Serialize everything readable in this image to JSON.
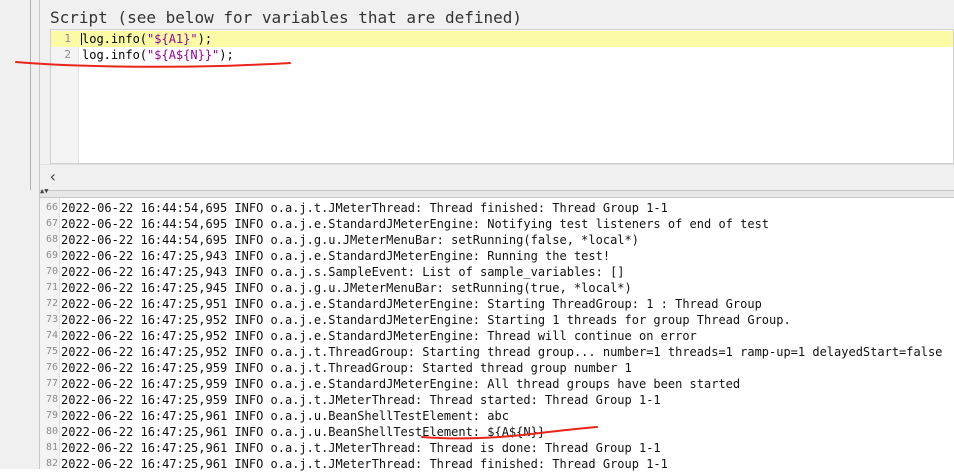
{
  "script": {
    "title": "Script (see below for variables that are defined)",
    "lines": [
      {
        "number": "1",
        "prefix": "log.info(",
        "string": "\"${A1}\"",
        "suffix": ");"
      },
      {
        "number": "2",
        "prefix": "log.info(",
        "string": "\"${A${N}}\"",
        "suffix": ");"
      }
    ],
    "scroll_left_icon": "chevron-left-icon"
  },
  "log": {
    "lines": [
      {
        "n": "66",
        "text": "2022-06-22 16:44:54,695 INFO o.a.j.t.JMeterThread: Thread finished: Thread Group 1-1"
      },
      {
        "n": "67",
        "text": "2022-06-22 16:44:54,695 INFO o.a.j.e.StandardJMeterEngine: Notifying test listeners of end of test"
      },
      {
        "n": "68",
        "text": "2022-06-22 16:44:54,695 INFO o.a.j.g.u.JMeterMenuBar: setRunning(false, *local*)"
      },
      {
        "n": "69",
        "text": "2022-06-22 16:47:25,943 INFO o.a.j.e.StandardJMeterEngine: Running the test!"
      },
      {
        "n": "70",
        "text": "2022-06-22 16:47:25,943 INFO o.a.j.s.SampleEvent: List of sample_variables: []"
      },
      {
        "n": "71",
        "text": "2022-06-22 16:47:25,945 INFO o.a.j.g.u.JMeterMenuBar: setRunning(true, *local*)"
      },
      {
        "n": "72",
        "text": "2022-06-22 16:47:25,951 INFO o.a.j.e.StandardJMeterEngine: Starting ThreadGroup: 1 : Thread Group"
      },
      {
        "n": "73",
        "text": "2022-06-22 16:47:25,952 INFO o.a.j.e.StandardJMeterEngine: Starting 1 threads for group Thread Group."
      },
      {
        "n": "74",
        "text": "2022-06-22 16:47:25,952 INFO o.a.j.e.StandardJMeterEngine: Thread will continue on error"
      },
      {
        "n": "75",
        "text": "2022-06-22 16:47:25,952 INFO o.a.j.t.ThreadGroup: Starting thread group... number=1 threads=1 ramp-up=1 delayedStart=false"
      },
      {
        "n": "76",
        "text": "2022-06-22 16:47:25,959 INFO o.a.j.t.ThreadGroup: Started thread group number 1"
      },
      {
        "n": "77",
        "text": "2022-06-22 16:47:25,959 INFO o.a.j.e.StandardJMeterEngine: All thread groups have been started"
      },
      {
        "n": "78",
        "text": "2022-06-22 16:47:25,959 INFO o.a.j.t.JMeterThread: Thread started: Thread Group 1-1"
      },
      {
        "n": "79",
        "text": "2022-06-22 16:47:25,961 INFO o.a.j.u.BeanShellTestElement: abc"
      },
      {
        "n": "80",
        "text": "2022-06-22 16:47:25,961 INFO o.a.j.u.BeanShellTestElement: ${A${N}}"
      },
      {
        "n": "81",
        "text": "2022-06-22 16:47:25,961 INFO o.a.j.t.JMeterThread: Thread is done: Thread Group 1-1"
      },
      {
        "n": "82",
        "text": "2022-06-22 16:47:25,961 INFO o.a.j.t.JMeterThread: Thread finished: Thread Group 1-1"
      }
    ]
  },
  "colors": {
    "annotation": "#e8251a",
    "active_line": "#fbfba6",
    "string": "#990099"
  }
}
